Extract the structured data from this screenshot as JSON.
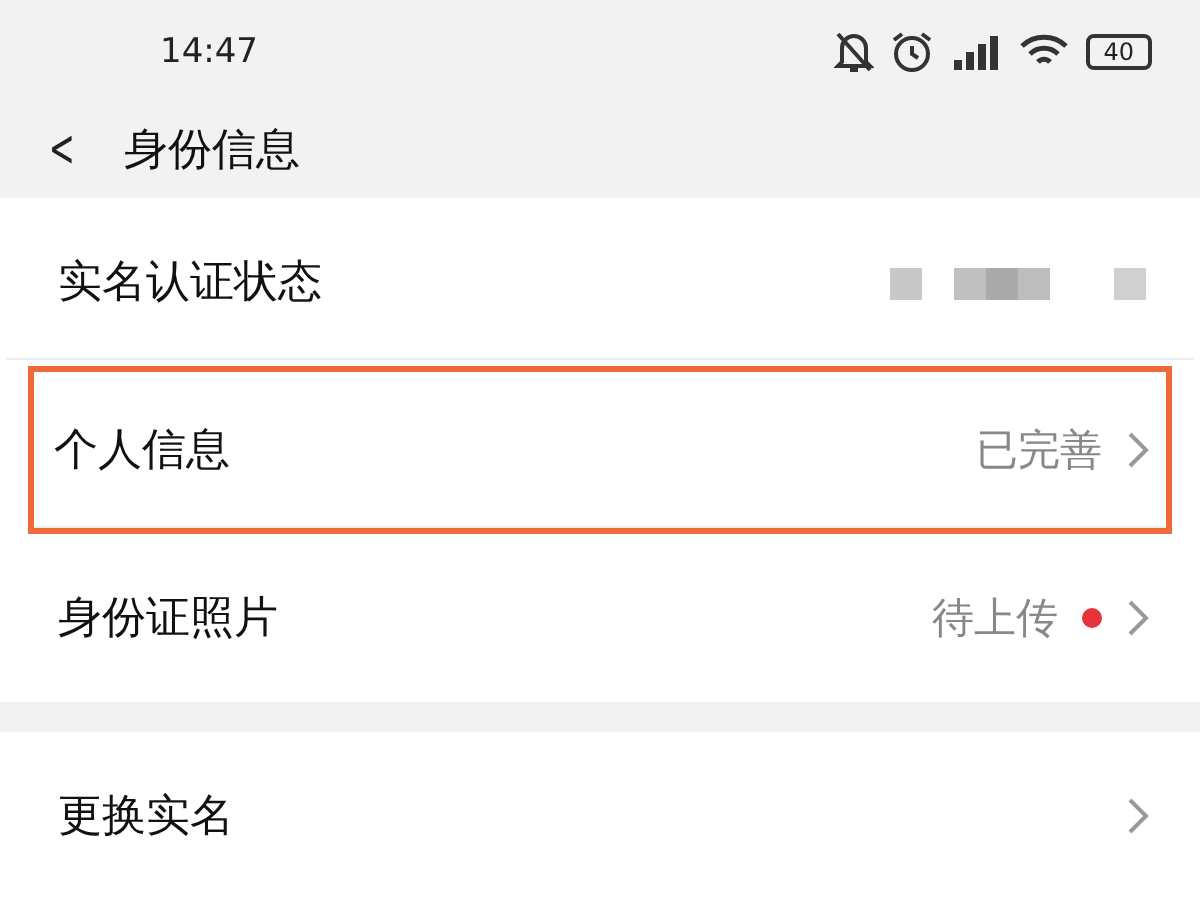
{
  "status_bar": {
    "time": "14:47",
    "battery": "40"
  },
  "header": {
    "back": "<",
    "title": "身份信息"
  },
  "rows": [
    {
      "label": "实名认证状态",
      "redacted": true,
      "chevron": false,
      "highlighted": false,
      "dot": false
    },
    {
      "label": "个人信息",
      "value": "已完善",
      "chevron": true,
      "highlighted": true,
      "dot": false
    },
    {
      "label": "身份证照片",
      "value": "待上传",
      "chevron": true,
      "highlighted": false,
      "dot": true
    }
  ],
  "rows_2": [
    {
      "label": "更换实名",
      "chevron": true
    }
  ]
}
